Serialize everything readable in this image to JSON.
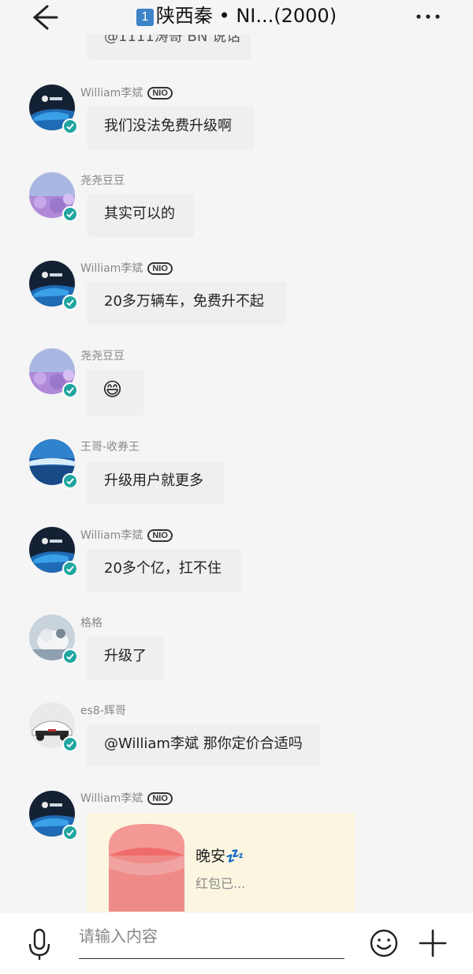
{
  "header": {
    "title_badge": "1",
    "title_text": "陕西秦 • NI...(2000)"
  },
  "chat": {
    "partial_top_text": "@1111涛哥 BN 说话",
    "messages": [
      {
        "sender": "William李斌",
        "nio_badge": "NIO",
        "text": "我们没法免费升级啊"
      },
      {
        "sender": "尧尧豆豆",
        "text": "其实可以的"
      },
      {
        "sender": "William李斌",
        "nio_badge": "NIO",
        "text": "20多万辆车，免费升不起"
      },
      {
        "sender": "尧尧豆豆",
        "text": "😄"
      },
      {
        "sender": "王哥-收券王",
        "text": "升级用户就更多"
      },
      {
        "sender": "William李斌",
        "nio_badge": "NIO",
        "text": "20多个亿，扛不住"
      },
      {
        "sender": "格格",
        "text": "升级了"
      },
      {
        "sender": "es8-辉哥",
        "text": "@William李斌 那你定价合适吗"
      },
      {
        "sender": "William李斌",
        "nio_badge": "NIO"
      }
    ],
    "red_packet": {
      "title": "晚安💤",
      "subtitle": "红包已..."
    }
  },
  "input": {
    "placeholder": "请输入内容"
  },
  "colors": {
    "verify_badge": "#21a6a0",
    "bubble": "#efefef",
    "red_packet_bg": "#fcf6e1"
  }
}
